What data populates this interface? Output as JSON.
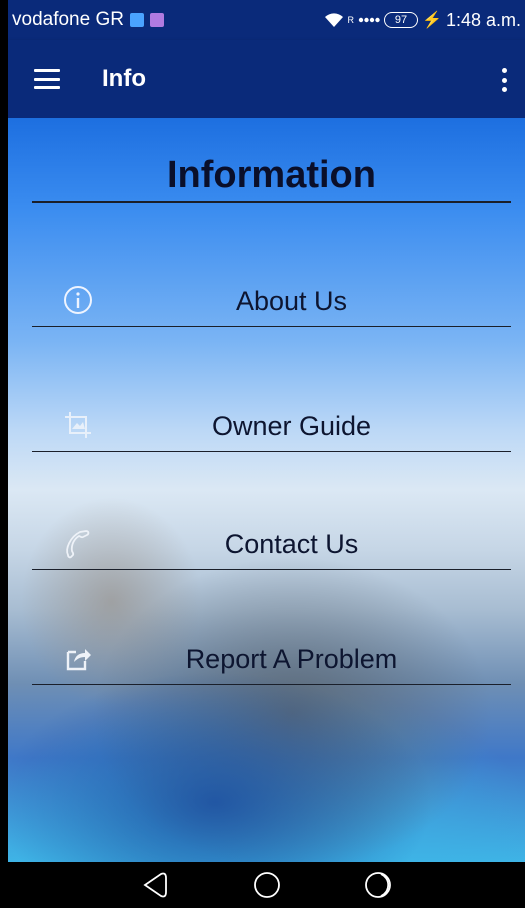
{
  "status_bar": {
    "carrier": "vodafone GR",
    "time": "1:48 a.m.",
    "battery": "97",
    "roaming_marker": "R",
    "notif_colors": [
      "#4aa3ff",
      "#b07be0"
    ]
  },
  "app_bar": {
    "title": "Info",
    "menu_icon": "hamburger-menu-icon",
    "overflow_icon": "overflow-menu-icon"
  },
  "heading": "Information",
  "menu": [
    {
      "label": "About Us",
      "icon": "info-circle-icon"
    },
    {
      "label": "Owner Guide",
      "icon": "crop-icon"
    },
    {
      "label": "Contact Us",
      "icon": "phone-icon"
    },
    {
      "label": "Report A Problem",
      "icon": "share-edit-icon"
    }
  ],
  "nav": {
    "back_icon": "back-icon",
    "home_icon": "home-icon",
    "recents_icon": "recents-icon"
  },
  "colors": {
    "app_bar": "#0a2a7a",
    "text_dark": "#0d1530"
  }
}
